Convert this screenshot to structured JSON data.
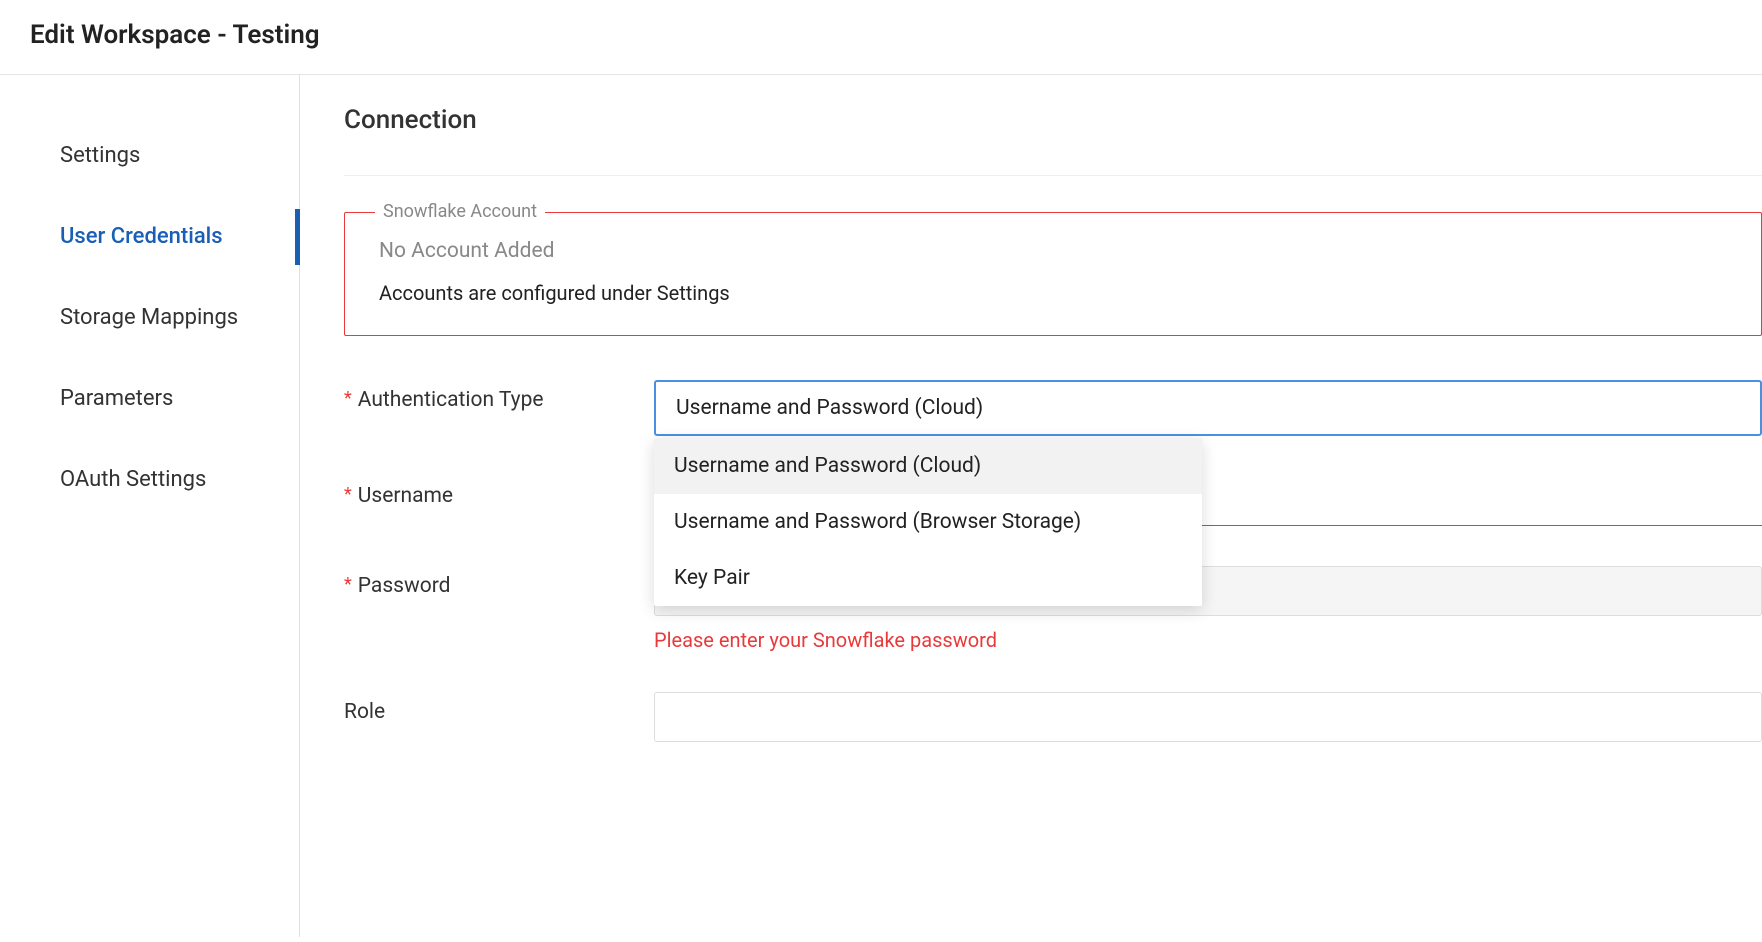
{
  "header": {
    "title": "Edit Workspace - Testing"
  },
  "sidebar": {
    "items": [
      {
        "label": "Settings",
        "active": false
      },
      {
        "label": "User Credentials",
        "active": true
      },
      {
        "label": "Storage Mappings",
        "active": false
      },
      {
        "label": "Parameters",
        "active": false
      },
      {
        "label": "OAuth Settings",
        "active": false
      }
    ]
  },
  "main": {
    "section_title": "Connection",
    "snowflake_box": {
      "legend": "Snowflake Account",
      "no_account": "No Account Added",
      "hint": "Accounts are configured under Settings"
    },
    "fields": {
      "auth_type": {
        "label": "Authentication Type",
        "required": true,
        "value": "Username and Password (Cloud)",
        "options": [
          "Username and Password (Cloud)",
          "Username and Password (Browser Storage)",
          "Key Pair"
        ]
      },
      "username": {
        "label": "Username",
        "required": true,
        "value": ""
      },
      "password": {
        "label": "Password",
        "required": true,
        "value": "",
        "error": "Please enter your Snowflake password"
      },
      "role": {
        "label": "Role",
        "required": false,
        "value": ""
      }
    }
  }
}
